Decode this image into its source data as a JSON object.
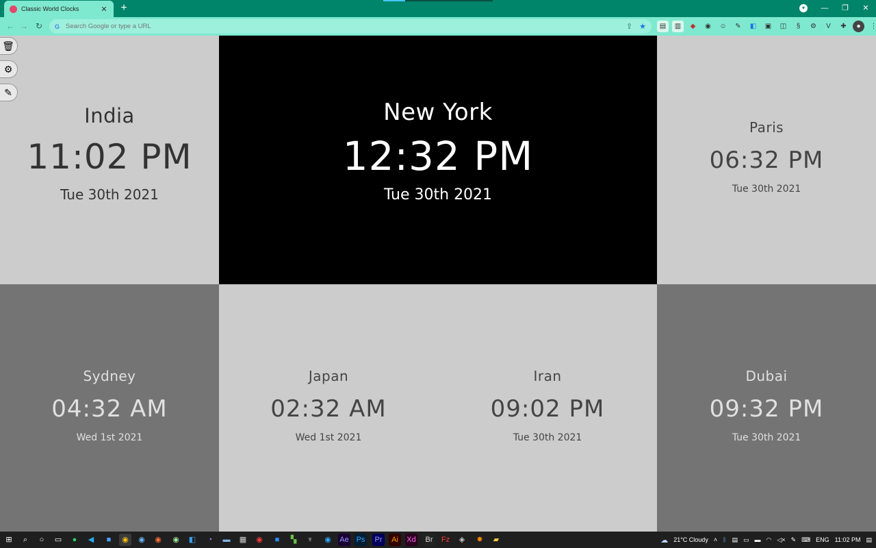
{
  "browser": {
    "tab_title": "Classic World Clocks",
    "tab_close": "✕",
    "new_tab": "+",
    "omnibox_placeholder": "Search Google or type a URL",
    "window_controls": {
      "minimize": "—",
      "restore": "❐",
      "close": "✕"
    }
  },
  "clocks": [
    {
      "city": "India",
      "time": "11:02 PM",
      "date": "Tue 30th 2021"
    },
    {
      "city": "New York",
      "time": "12:32 PM",
      "date": "Tue 30th 2021"
    },
    {
      "city": "Paris",
      "time": "06:32 PM",
      "date": "Tue 30th 2021"
    },
    {
      "city": "Sydney",
      "time": "04:32 AM",
      "date": "Wed 1st 2021"
    },
    {
      "city": "Japan",
      "time": "02:32 AM",
      "date": "Wed 1st 2021"
    },
    {
      "city": "Iran",
      "time": "09:02 PM",
      "date": "Tue 30th 2021"
    },
    {
      "city": "Dubai",
      "time": "09:32 PM",
      "date": "Tue 30th 2021"
    }
  ],
  "colors": {
    "tab_bar": "#00846a",
    "toolbar": "#7fe9cf",
    "light_tile": "#cccccc",
    "dark_tile": "#747474",
    "featured_tile": "#000000"
  },
  "taskbar": {
    "weather": "21°C  Cloudy",
    "language": "ENG",
    "clock": "11:02 PM"
  }
}
